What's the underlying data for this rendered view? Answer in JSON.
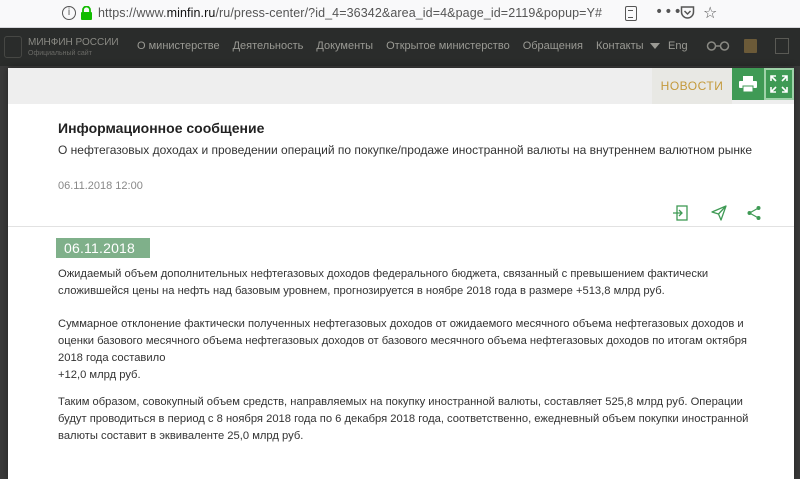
{
  "browser": {
    "url_prefix": "https://www.",
    "url_host": "minfin.ru",
    "url_path": "/ru/press-center/?id_4=36342&area_id=4&page_id=2119&popup=Y#",
    "info_glyph": "i",
    "dots_glyph": "•••",
    "star_glyph": "☆"
  },
  "site_nav": {
    "logo_text": "МИНФИН РОССИИ",
    "logo_sub": "Официальный сайт",
    "items": [
      "О министерстве",
      "Деятельность",
      "Документы",
      "Открытое министерство",
      "Обращения",
      "Контакты"
    ],
    "lang": "Eng"
  },
  "modal": {
    "tab_label": "НОВОСТИ",
    "title": "Информационное сообщение",
    "subtitle": "О нефтегазовых доходах и проведении операций по покупке/продаже иностранной валюты на внутреннем валютном рынке",
    "datetime": "06.11.2018 12:00",
    "date_badge": "06.11.2018",
    "paragraphs": [
      "Ожидаемый объем дополнительных нефтегазовых доходов федерального бюджета, связанный с превышением фактически сложившейся цены на нефть над базовым уровнем, прогнозируется в ноябре 2018 года в размере +513,8 млрд руб.",
      "Суммарное отклонение фактически полученных нефтегазовых доходов от ожидаемого месячного объема нефтегазовых доходов и оценки базового месячного объема нефтегазовых доходов от базового месячного объема нефтегазовых доходов по итогам октября 2018 года составило",
      "+12,0 млрд руб.",
      "Таким образом, совокупный объем средств, направляемых на покупку иностранной валюты, составляет 525,8 млрд руб. Операции будут проводиться в период с 8 ноября 2018 года по 6 декабря 2018 года, соответственно, ежедневный объем покупки иностранной валюты составит в эквиваленте 25,0 млрд руб."
    ]
  },
  "colors": {
    "accent_green": "#3f9a55",
    "badge_green": "#7fb08a",
    "news_gold": "#c49a3c"
  },
  "icons": [
    "info-icon",
    "lock-icon",
    "reader-view-icon",
    "more-icon",
    "pocket-icon",
    "bookmark-star-icon",
    "print-icon",
    "expand-icon",
    "export-icon",
    "send-icon",
    "share-icon"
  ]
}
